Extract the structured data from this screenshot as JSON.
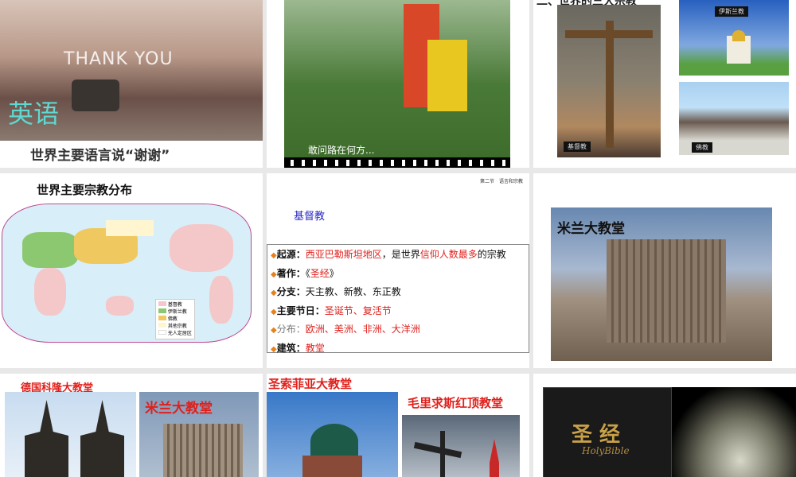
{
  "slides": [
    {
      "caption_big": "英语",
      "thank_you": "THANK YOU",
      "caption": "世界主要语言说“谢谢”"
    },
    {
      "caption": "敢问路在何方..."
    },
    {
      "title": "二、世界的三大宗教",
      "labels": [
        "基督教",
        "伊斯兰教",
        "佛教"
      ]
    },
    {
      "title": "世界主要宗教分布",
      "legend": [
        {
          "label": "基督教",
          "color": "#f4c8c8"
        },
        {
          "label": "伊斯兰教",
          "color": "#8cc870"
        },
        {
          "label": "佛教",
          "color": "#f0c860"
        },
        {
          "label": "其他宗教",
          "color": "#fff6d0"
        },
        {
          "label": "无人定居区",
          "color": "#ffffff"
        }
      ]
    },
    {
      "header": "第二节　语言和宗教",
      "title": "基督教",
      "rows": [
        {
          "key": "起源：",
          "parts": [
            {
              "t": "西亚巴勒斯坦地区",
              "red": true
            },
            {
              "t": "，是世界",
              "red": false
            },
            {
              "t": "信仰人数最多",
              "red": true
            },
            {
              "t": "的宗教",
              "red": false
            }
          ]
        },
        {
          "key": "著作：",
          "parts": [
            {
              "t": "《",
              "red": false
            },
            {
              "t": "圣经",
              "red": true
            },
            {
              "t": "》",
              "red": false
            }
          ]
        },
        {
          "key": "分支：",
          "parts": [
            {
              "t": "天主教、新教、东正教",
              "red": false
            }
          ]
        },
        {
          "key": "主要节日：",
          "parts": [
            {
              "t": "圣诞节、复活节",
              "red": true
            }
          ]
        },
        {
          "key": "分布：",
          "parts": [
            {
              "t": "欧洲、美洲、非洲、大洋洲",
              "red": true
            }
          ]
        },
        {
          "key": "建筑：",
          "parts": [
            {
              "t": "教堂",
              "red": true
            }
          ]
        }
      ]
    },
    {
      "caption": "米兰大教堂"
    },
    {
      "caption1": "德国科隆大教堂",
      "caption2": "米兰大教堂"
    },
    {
      "caption1": "圣索菲亚大教堂",
      "caption2": "毛里求斯红顶教堂"
    },
    {
      "bible_title": "圣 经",
      "bible_sub": "HolyBible"
    }
  ]
}
